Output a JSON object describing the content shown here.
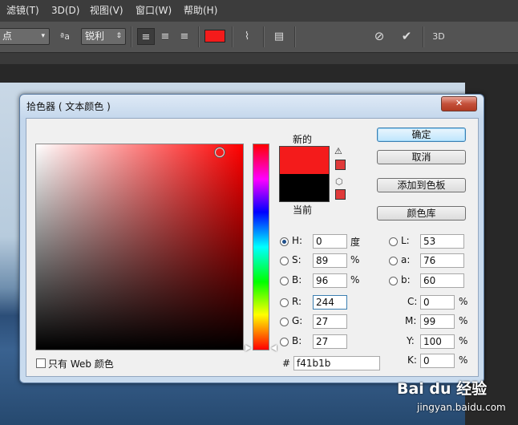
{
  "menubar": {
    "items": [
      "滤镜(T)",
      "3D(D)",
      "视图(V)",
      "窗口(W)",
      "帮助(H)"
    ]
  },
  "options_bar": {
    "font_size_value": "点",
    "aa_label": "ªa",
    "aa_value": "锐利",
    "text_color": "#f41b1b",
    "threed_label": "3D"
  },
  "dialog": {
    "title": "拾色器 ( 文本颜色 )",
    "close_label": "✕",
    "new_label": "新的",
    "current_label": "当前",
    "new_color": "#f41b1b",
    "current_color": "#000000",
    "buttons": {
      "ok": "确定",
      "cancel": "取消",
      "add_to_swatches": "添加到色板",
      "color_libraries": "颜色库"
    },
    "hsb": {
      "h_label": "H:",
      "h_value": "0",
      "h_unit": "度",
      "s_label": "S:",
      "s_value": "89",
      "s_unit": "%",
      "b_label": "B:",
      "b_value": "96",
      "b_unit": "%"
    },
    "rgb": {
      "r_label": "R:",
      "r_value": "244",
      "g_label": "G:",
      "g_value": "27",
      "b_label": "B:",
      "b_value": "27"
    },
    "lab": {
      "l_label": "L:",
      "l_value": "53",
      "a_label": "a:",
      "a_value": "76",
      "b_label": "b:",
      "b_value": "60"
    },
    "cmyk": {
      "c_label": "C:",
      "c_value": "0",
      "m_label": "M:",
      "m_value": "99",
      "y_label": "Y:",
      "y_value": "100",
      "k_label": "K:",
      "k_value": "0",
      "unit": "%"
    },
    "hex_label": "#",
    "hex_value": "f41b1b",
    "web_only_label": "只有 Web 颜色"
  },
  "watermark": {
    "logo": "Bai du 经验",
    "url": "jingyan.baidu.com"
  }
}
